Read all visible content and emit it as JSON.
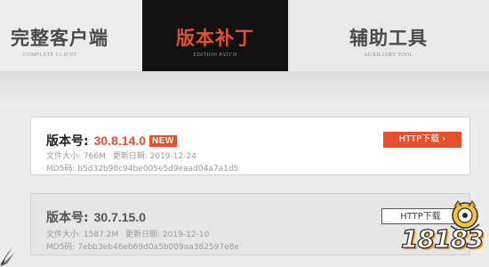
{
  "tabs": [
    {
      "title": "完整客户端",
      "subtitle": "COMPLETE CLIENT",
      "active": false
    },
    {
      "title": "版本补丁",
      "subtitle": "EDITION PATCH",
      "active": true
    },
    {
      "title": "辅助工具",
      "subtitle": "AUXILIARY TOOL",
      "active": false
    }
  ],
  "versions": [
    {
      "label": "版本号:",
      "number": "30.8.14.0",
      "badge": "NEW",
      "size": "文件大小:  766M",
      "date": "更新日期:  2019-12-24",
      "md5": "MD5码:  b5d32b98c94be005e5d9eaad04a7a1d5",
      "button": "HTTP下载 ›"
    },
    {
      "label": "版本号:",
      "number": "30.7.15.0",
      "size": "文件大小:  1587.2M",
      "date": "更新日期:  2019-12-10",
      "md5": "MD5码:  7ebb3eb46eb69d0a5b009aa382597e8e",
      "button": "HTTP下载"
    }
  ],
  "watermark": {
    "text": "18183"
  },
  "colors": {
    "accent": "#e5502e",
    "tab_active_bg": "#111111",
    "page_bg": "#ececec"
  }
}
